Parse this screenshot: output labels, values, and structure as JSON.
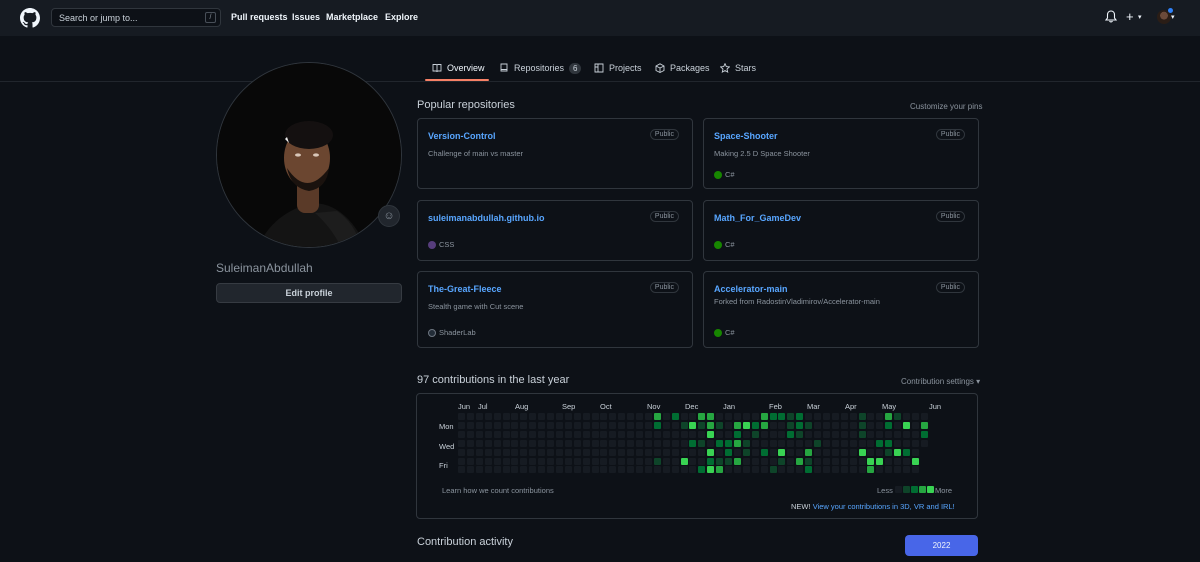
{
  "header": {
    "search_placeholder": "Search or jump to...",
    "search_shortcut": "/",
    "nav": [
      "Pull requests",
      "Issues",
      "Marketplace",
      "Explore"
    ],
    "plus_label": "+"
  },
  "tabs": [
    {
      "label": "Overview",
      "icon": "book-icon",
      "active": true
    },
    {
      "label": "Repositories",
      "icon": "repo-icon",
      "count": "6"
    },
    {
      "label": "Projects",
      "icon": "project-icon"
    },
    {
      "label": "Packages",
      "icon": "package-icon"
    },
    {
      "label": "Stars",
      "icon": "star-icon"
    }
  ],
  "profile": {
    "username": "SuleimanAbdullah",
    "edit_label": "Edit profile"
  },
  "popular": {
    "title": "Popular repositories",
    "customize": "Customize your pins",
    "repos": [
      {
        "name": "Version-Control",
        "visibility": "Public",
        "desc": "Challenge of main vs master",
        "lang": "",
        "lang_color": ""
      },
      {
        "name": "Space-Shooter",
        "visibility": "Public",
        "desc": "Making 2.5 D Space Shooter",
        "lang": "C#",
        "lang_color": "#178600"
      },
      {
        "name": "suleimanabdullah.github.io",
        "visibility": "Public",
        "desc": "",
        "lang": "CSS",
        "lang_color": "#563d7c"
      },
      {
        "name": "Math_For_GameDev",
        "visibility": "Public",
        "desc": "",
        "lang": "C#",
        "lang_color": "#178600"
      },
      {
        "name": "The-Great-Fleece",
        "visibility": "Public",
        "desc": "Stealth game with Cut scene",
        "lang": "ShaderLab",
        "lang_color": "#222c37"
      },
      {
        "name": "Accelerator-main",
        "visibility": "Public",
        "desc": "Forked from RadostinVladimirov/Accelerator-main",
        "lang": "C#",
        "lang_color": "#178600"
      }
    ]
  },
  "contrib": {
    "title": "97 contributions in the last year",
    "settings": "Contribution settings ▾",
    "months": [
      "Jun",
      "Jul",
      "Aug",
      "Sep",
      "Oct",
      "Nov",
      "Dec",
      "Jan",
      "Feb",
      "Mar",
      "Apr",
      "May",
      "Jun"
    ],
    "days": [
      "Mon",
      "Wed",
      "Fri"
    ],
    "learn": "Learn how we count contributions",
    "less": "Less",
    "more": "More",
    "new_prefix": "NEW!",
    "new_link": "View your contributions in 3D, VR and IRL!",
    "levels": {
      "colors": [
        "#161b22",
        "#0e4429",
        "#006d32",
        "#26a641",
        "#39d353"
      ]
    }
  },
  "activity": {
    "title": "Contribution activity",
    "year": "2022"
  }
}
